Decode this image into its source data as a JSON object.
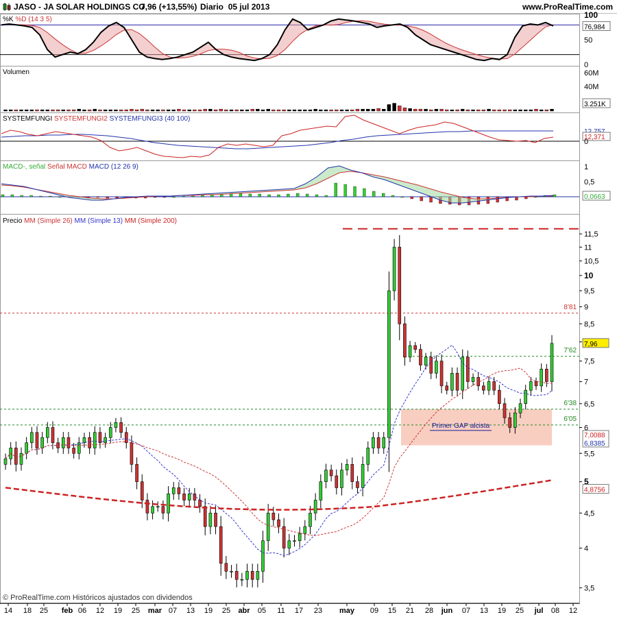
{
  "header": {
    "ticker": "JASO - JA SOLAR HOLDINGS CO.",
    "price": "7,96 (+13,55%)",
    "period": "Diario",
    "date": "05 jul 2013",
    "site": "www.ProRealTime.com"
  },
  "footer": "© ProRealTime.com Históricos ajustados con dividendos",
  "panels": {
    "stoch": {
      "title_k": "%K",
      "title_d": "%D",
      "params": "(14 3 5)",
      "ticks": [
        "100",
        "50",
        "0"
      ],
      "last_value": "76,984"
    },
    "volume": {
      "title": "Volumen",
      "ticks": [
        "60M",
        "40M"
      ],
      "last_value": "3.251K"
    },
    "fungi": {
      "title1": "SYSTEMFUNGI",
      "title2": "SYSTEMFUNGI2",
      "title3": "SYSTEMFUNGI3",
      "params": "(40 100)",
      "last_value1": "12,371",
      "last_value2": "12,757",
      "zero": "0"
    },
    "macd": {
      "title1": "MACD-",
      "title2": ", señal",
      "title3": "Señal MACD",
      "title4": "MACD",
      "params": "(12 26 9)",
      "ticks": [
        "1",
        "0,5"
      ],
      "last_value": "0,0663"
    },
    "price": {
      "title": "Precio",
      "ma1": "MM",
      "ma1_params": "(Simple 26)",
      "ma2": "MM",
      "ma2_params": "(Simple 13)",
      "ma3": "MM",
      "ma3_params": "(Simple 200)",
      "level_881": "8'81",
      "level_762": "7'62",
      "level_638": "6'38",
      "level_605": "6'05",
      "last_price": "7,96",
      "ma_value1": "7,0088",
      "ma_value2": "6,8385",
      "ma_value3": "4,8756",
      "gap_label": "Primer GAP alcista"
    }
  },
  "colors": {
    "bull": "#33cc33",
    "bear": "#cc3333",
    "ma26": "#cc3333",
    "ma13": "#3333cc",
    "ma200": "#cc2222",
    "gap_zone": "#f7c6b6"
  },
  "chart_data": {
    "type": "candlestick",
    "title": "JASO - JA SOLAR HOLDINGS CO.",
    "x_tick_labels": [
      "14",
      "18",
      "25",
      "feb",
      "06",
      "12",
      "19",
      "25",
      "mar",
      "07",
      "13",
      "19",
      "25",
      "abr",
      "05",
      "11",
      "17",
      "23",
      "may",
      "09",
      "15",
      "21",
      "28",
      "jun",
      "07",
      "13",
      "19",
      "25",
      "jul",
      "08",
      "12"
    ],
    "y_tick_labels": [
      "11,5",
      "11",
      "10,5",
      "10",
      "9,5",
      "9",
      "8,5",
      "8",
      "7,5",
      "7",
      "6,5",
      "6",
      "5,5",
      "5",
      "4,5",
      "4",
      "3,5"
    ],
    "ylim": [
      3.4,
      11.8
    ],
    "y_scale": "log",
    "reference_levels": [
      8.81,
      7.62,
      6.38,
      6.05
    ],
    "gap_zone": [
      5.65,
      6.38
    ],
    "moving_averages": {
      "sma26_last": 7.0088,
      "sma13_last": 6.8385,
      "sma200_last": 4.8756
    },
    "closes": [
      5.4,
      5.6,
      5.3,
      5.5,
      5.7,
      5.9,
      5.6,
      5.8,
      6.0,
      5.7,
      5.6,
      5.8,
      5.6,
      5.5,
      5.7,
      5.8,
      5.6,
      5.9,
      5.7,
      5.8,
      6.0,
      6.1,
      5.9,
      5.7,
      5.3,
      5.0,
      4.7,
      4.5,
      4.6,
      4.6,
      4.5,
      4.8,
      4.9,
      4.8,
      4.7,
      4.8,
      4.7,
      4.6,
      4.3,
      4.5,
      4.3,
      3.8,
      3.7,
      3.7,
      3.6,
      3.6,
      3.7,
      3.6,
      3.7,
      4.1,
      4.5,
      4.4,
      4.3,
      4.0,
      4.1,
      4.1,
      4.2,
      4.3,
      4.5,
      4.7,
      5.0,
      5.2,
      5.1,
      4.9,
      5.2,
      5.3,
      5.0,
      4.9,
      5.3,
      5.6,
      5.8,
      5.6,
      5.8,
      9.5,
      11.0,
      8.5,
      7.6,
      7.9,
      7.8,
      7.4,
      7.6,
      7.2,
      7.5,
      6.9,
      6.8,
      7.2,
      6.8,
      7.6,
      7.0,
      7.1,
      6.9,
      6.8,
      7.0,
      6.8,
      6.5,
      6.2,
      6.0,
      6.3,
      6.5,
      6.8,
      7.0,
      6.9,
      7.3,
      7.0,
      7.96
    ],
    "volumes_m": [
      2,
      2,
      2,
      2,
      2,
      2,
      2,
      2,
      2,
      2,
      2,
      2,
      2,
      2,
      3,
      2,
      2,
      3,
      2,
      2,
      2,
      2,
      2,
      2,
      3,
      2,
      3,
      2,
      2,
      2,
      2,
      2,
      2,
      3,
      2,
      2,
      2,
      2,
      3,
      3,
      2,
      3,
      2,
      2,
      2,
      2,
      2,
      3,
      3,
      2,
      3,
      2,
      2,
      2,
      2,
      2,
      2,
      2,
      2,
      3,
      2,
      2,
      2,
      2,
      2,
      2,
      2,
      3,
      3,
      3,
      3,
      4,
      3,
      10,
      12,
      8,
      5,
      4,
      3,
      3,
      3,
      2,
      3,
      3,
      2,
      2,
      2,
      3,
      2,
      2,
      2,
      2,
      3,
      2,
      2,
      2,
      2,
      2,
      2,
      2,
      2,
      3,
      2,
      2,
      3
    ]
  }
}
